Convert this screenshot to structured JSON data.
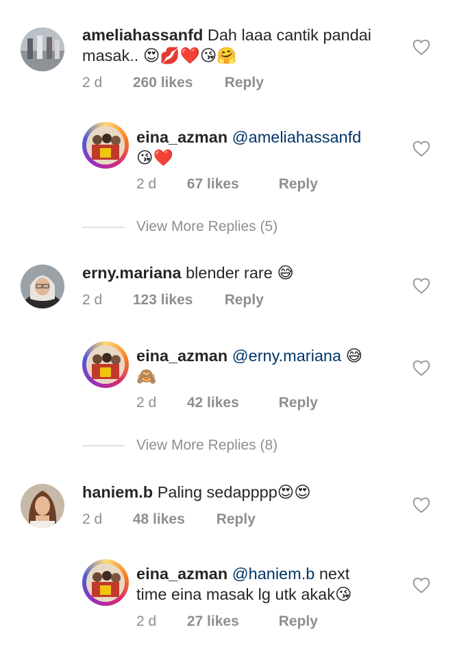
{
  "comments": [
    {
      "username": "ameliahassanfd",
      "text_line1": "Dah laaa cantik pandai",
      "text_line2": "masak..",
      "emojis": "😍💋❤️😘🤗",
      "time": "2 d",
      "likes": "260 likes",
      "reply": "Reply"
    },
    {
      "username": "erny.mariana",
      "text_line1": "blender rare",
      "emojis": "😅",
      "time": "2 d",
      "likes": "123 likes",
      "reply": "Reply"
    },
    {
      "username": "haniem.b",
      "text_line1": "Paling sedapppp",
      "emojis": "😍😍",
      "time": "2 d",
      "likes": "48 likes",
      "reply": "Reply"
    }
  ],
  "replies": [
    {
      "username": "eina_azman",
      "mention": "@ameliahassanfd",
      "text_line2": "",
      "emojis": "😘❤️",
      "time": "2 d",
      "likes": "67 likes",
      "reply": "Reply"
    },
    {
      "username": "eina_azman",
      "mention": "@erny.mariana",
      "emojis_inline": "😅",
      "emojis": "🙈",
      "time": "2 d",
      "likes": "42 likes",
      "reply": "Reply"
    },
    {
      "username": "eina_azman",
      "mention": "@haniem.b",
      "text_line1": "next",
      "text_line2": "time eina masak lg utk akak",
      "emojis": "😘",
      "time": "2 d",
      "likes": "27 likes",
      "reply": "Reply"
    }
  ],
  "view_more": [
    "View More Replies (5)",
    "View More Replies (8)"
  ],
  "colors": {
    "mention": "#003569",
    "meta": "#8e8e8e",
    "text": "#262626"
  }
}
